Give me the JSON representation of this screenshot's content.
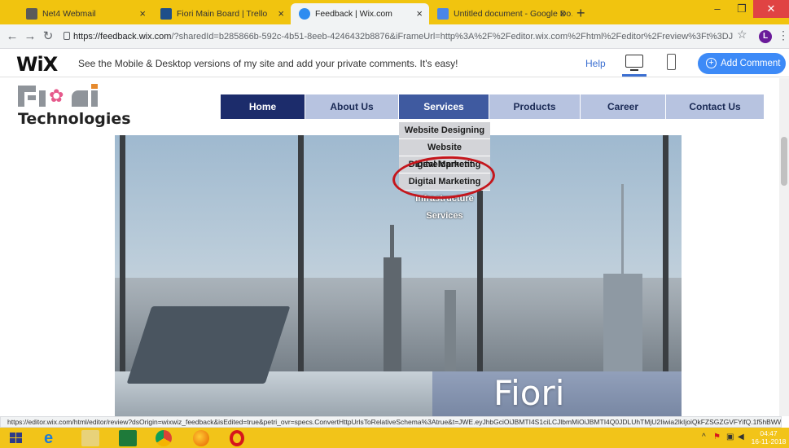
{
  "browser": {
    "tabs": [
      {
        "title": "Net4 Webmail",
        "color": "#5a5a5a"
      },
      {
        "title": "Fiori Main Board | Trello",
        "color": "#1e4f8a"
      },
      {
        "title": "Feedback | Wix.com",
        "color": "#2e8cf0"
      },
      {
        "title": "Untitled document - Google Do…",
        "color": "#4a86e8"
      }
    ],
    "new_tab": "+",
    "url_host": "https://feedback.wix.com",
    "url_rest": "/?sharedId=b285866b-592c-4b51-8eeb-4246432b8876&iFrameUrl=http%3A%2F%2Feditor.wix.com%2Fhtml%2Feditor%2Freview%3Ft%3DJWE.eyJhbGc...",
    "profile_initial": "L"
  },
  "wix": {
    "logo": "WiX",
    "message": "See the Mobile & Desktop versions of my site and add your private comments. It's easy!",
    "help": "Help",
    "add_comment": "Add Comment"
  },
  "site": {
    "logo_word": "Technologies",
    "nav": [
      {
        "label": "Home",
        "width": 104
      },
      {
        "label": "About Us",
        "width": 115
      },
      {
        "label": "Services",
        "width": 111
      },
      {
        "label": "Products",
        "width": 112
      },
      {
        "label": "Career",
        "width": 105
      },
      {
        "label": "Contact Us",
        "width": 121
      }
    ],
    "services_dropdown": [
      "Website Designing",
      "Website Development",
      "Digital Marketing",
      "Digital Marketing",
      "Infrastructure Services"
    ],
    "hero_text": "Fiori"
  },
  "statusbar": "https://editor.wix.com/html/editor/review?dsOrigin=wixwiz_feedback&isEdited=true&petri_ovr=specs.ConvertHttpUrlsToRelativeSchema%3Atrue&t=JWE.eyJhbGciOiJBMTI4S1ciLCJlbmMiOiJBMTI4Q0JDLUhTMjU2Iiwia2lkIjoiQkFZSGZGVFYifQ.1f5hBWW...",
  "taskbar": {
    "time": "04:47",
    "date": "16-11-2018"
  },
  "colors": {
    "taskbar": "#f2c419",
    "nav_home": "#1c2c6b",
    "nav_active": "#3f5aa0",
    "nav_item": "#b7c3e0",
    "wix_button": "#3d8af7",
    "highlight": "#c4161c"
  }
}
